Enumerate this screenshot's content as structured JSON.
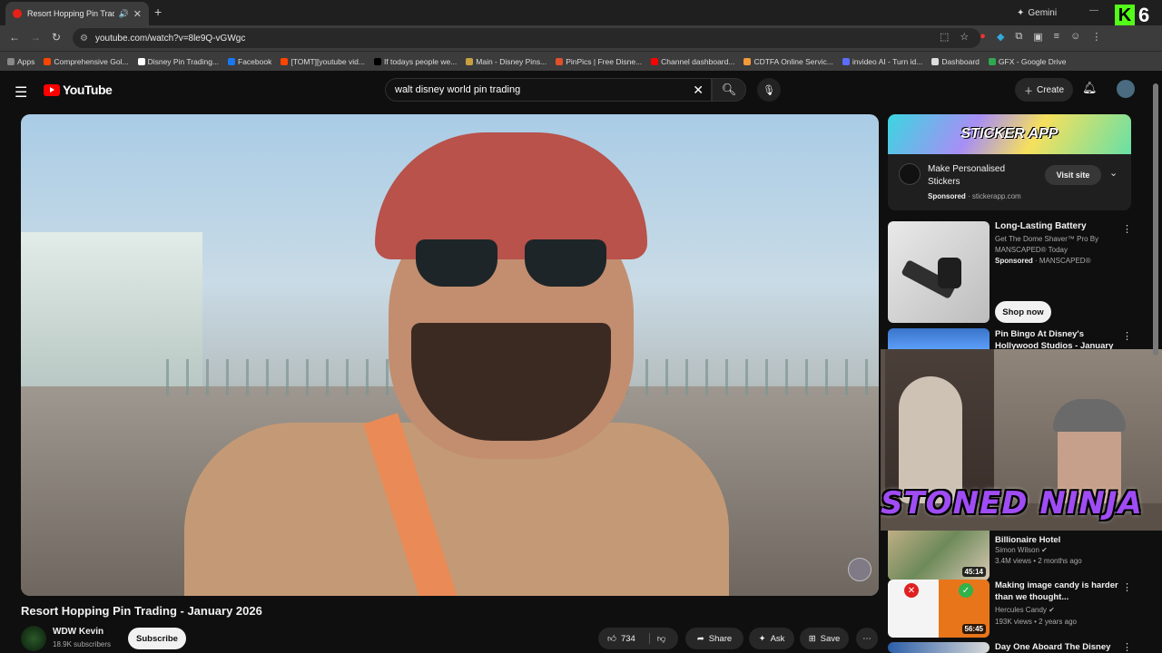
{
  "browser": {
    "tab_title": "Resort Hopping Pin Trading",
    "new_tab": "+",
    "gemini_label": "Gemini",
    "url": "youtube.com/watch?v=8le9Q-vGWgc",
    "bookmarks": [
      {
        "label": "Apps",
        "color": "#888888"
      },
      {
        "label": "Comprehensive Gol...",
        "color": "#ff4500"
      },
      {
        "label": "Disney Pin Trading...",
        "color": "#ffffff"
      },
      {
        "label": "Facebook",
        "color": "#1877f2"
      },
      {
        "label": "[TOMT][youtube vid...",
        "color": "#ff4500"
      },
      {
        "label": "If todays people we...",
        "color": "#000000"
      },
      {
        "label": "Main - Disney Pins...",
        "color": "#c8a040"
      },
      {
        "label": "PinPics | Free Disne...",
        "color": "#e0502a"
      },
      {
        "label": "Channel dashboard...",
        "color": "#ff0000"
      },
      {
        "label": "CDTFA Online Servic...",
        "color": "#f29b38"
      },
      {
        "label": "invideo AI - Turn id...",
        "color": "#5b6cff"
      },
      {
        "label": "Dashboard",
        "color": "#dddddd"
      },
      {
        "label": "GFX - Google Drive",
        "color": "#2fa84f"
      }
    ]
  },
  "overlay_kick": {
    "logo_letter": "K",
    "count": "6"
  },
  "youtube": {
    "logo_text": "YouTube",
    "search_query": "walt disney world pin trading",
    "create_label": "Create"
  },
  "video": {
    "title": "Resort Hopping Pin Trading - January 2026",
    "channel": "WDW Kevin",
    "subscribers": "18.9K subscribers",
    "subscribe_label": "Subscribe",
    "likes": "734",
    "share_label": "Share",
    "ask_label": "Ask",
    "save_label": "Save"
  },
  "ad": {
    "banner_text": "STICKER APP",
    "title": "Make Personalised Stickers",
    "sponsored": "Sponsored",
    "domain": "stickerapp.com",
    "visit_label": "Visit site"
  },
  "ad2": {
    "title": "Long-Lasting Battery",
    "subtitle": "Get The Dome Shaver™ Pro By MANSCAPED® Today",
    "sponsored": "Sponsored",
    "advertiser": "MANSCAPED®",
    "cta": "Shop now"
  },
  "recommendations": [
    {
      "title": "Pin Bingo At Disney's Hollywood Studios - January 2026",
      "channel": "",
      "meta": "",
      "duration": ""
    },
    {
      "title": "I Tried America's Secret Billionaire Hotel",
      "channel": "Simon Wilson",
      "meta": "3.4M views • 2 months ago",
      "duration": "45:14"
    },
    {
      "title": "Making image candy is harder than we thought...",
      "channel": "Hercules Candy",
      "meta": "193K views • 2 years ago",
      "duration": "56:45"
    },
    {
      "title": "Day One Aboard The Disney",
      "channel": "",
      "meta": "",
      "duration": ""
    }
  ],
  "stream_overlay": {
    "text": "STONED NINJA"
  }
}
